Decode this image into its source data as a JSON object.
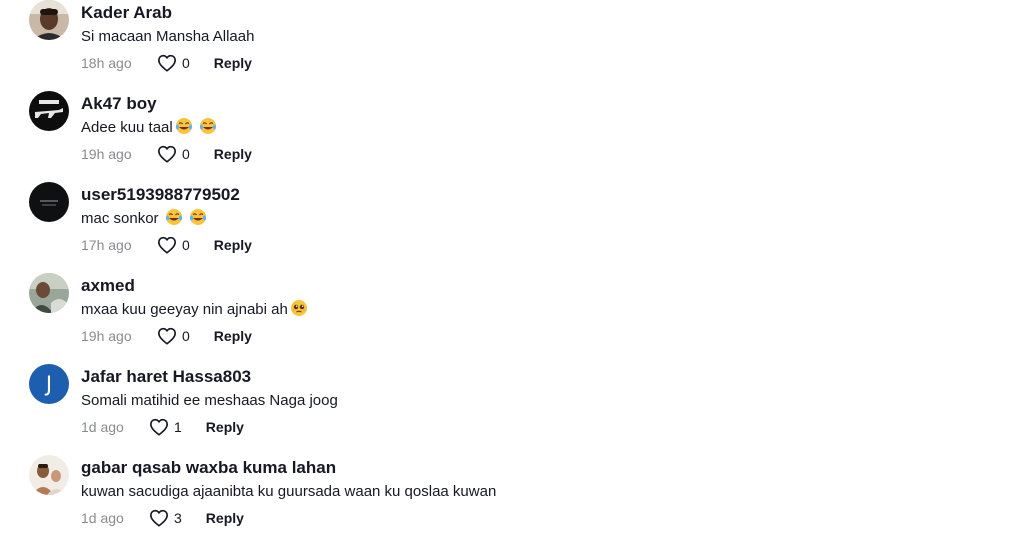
{
  "reply_label": "Reply",
  "comments": [
    {
      "username": "Kader Arab",
      "text": "Si macaan Mansha Allaah",
      "time": "18h ago",
      "likes": "0",
      "avatar_icon": "person-photo-icon",
      "emojis": []
    },
    {
      "username": "Ak47 boy",
      "text": "Adee kuu taal",
      "time": "19h ago",
      "likes": "0",
      "avatar_icon": "ak47-logo-icon",
      "emojis": [
        "tears-of-joy",
        "tears-of-joy"
      ]
    },
    {
      "username": "user5193988779502",
      "text": "mac sonkor ",
      "time": "17h ago",
      "likes": "0",
      "avatar_icon": "dark-photo-icon",
      "emojis": [
        "tears-of-joy",
        "tears-of-joy"
      ]
    },
    {
      "username": "axmed",
      "text": "mxaa kuu geeyay nin ajnabi ah",
      "time": "19h ago",
      "likes": "0",
      "avatar_icon": "person-photo-icon",
      "emojis": [
        "pleading-face"
      ]
    },
    {
      "username": "Jafar haret Hassa803",
      "text": "Somali matihid ee meshaas Naga joog",
      "time": "1d ago",
      "likes": "1",
      "avatar_letter": "J",
      "avatar_color": "#1d5fae",
      "emojis": []
    },
    {
      "username": "gabar qasab waxba kuma lahan",
      "text": "kuwan sacudiga ajaanibta ku guursada waan ku qoslaa kuwan",
      "time": "1d ago",
      "likes": "3",
      "avatar_icon": "couple-photo-icon",
      "emojis": []
    }
  ]
}
